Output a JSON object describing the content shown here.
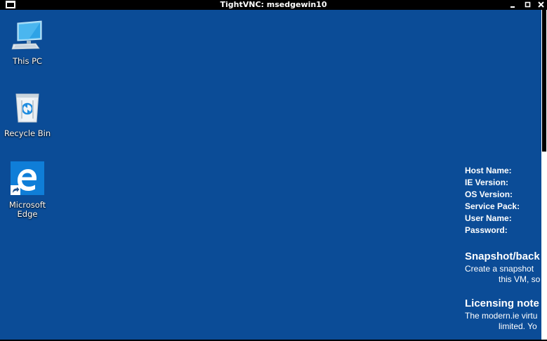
{
  "window": {
    "title": "TightVNC: msedgewin10"
  },
  "desktop": {
    "background_color": "#0b4c97",
    "icons": [
      {
        "label": "This PC",
        "icon": "computer-icon"
      },
      {
        "label": "Recycle Bin",
        "icon": "recycle-bin-icon"
      },
      {
        "label": "Microsoft Edge",
        "icon": "edge-icon"
      }
    ]
  },
  "bginfo": {
    "fields": [
      "Host Name:",
      "IE Version:",
      "OS Version:",
      "Service Pack:",
      "User Name:",
      "Password:"
    ],
    "snapshot_heading": "Snapshot/back",
    "snapshot_line1": "Create a snapshot",
    "snapshot_line2": "this VM, so",
    "licensing_heading": "Licensing note",
    "licensing_line1": "The modern.ie virtu",
    "licensing_line2": "limited. Yo"
  }
}
